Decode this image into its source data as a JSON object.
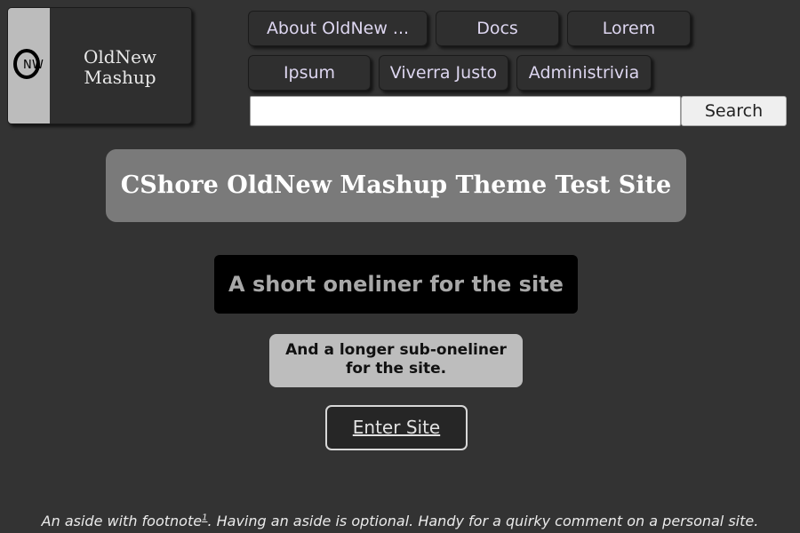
{
  "logo": {
    "line1": "OldNew",
    "line2": "Mashup",
    "mark_letters": [
      "O",
      "N",
      "W"
    ]
  },
  "nav": {
    "items": [
      "About OldNew ...",
      "Docs",
      "Lorem",
      "Ipsum",
      "Viverra Justo",
      "Administrivia"
    ]
  },
  "search": {
    "value": "",
    "placeholder": "",
    "button_label": "Search"
  },
  "site": {
    "title": "CShore OldNew Mashup Theme Test Site",
    "oneliner": "A short oneliner for the site",
    "sub_oneliner_line1": "And a longer sub-oneliner",
    "sub_oneliner_line2": "for the site.",
    "enter_label": "Enter Site"
  },
  "aside": {
    "before": "An aside with footnote",
    "footnote_ref": "1",
    "after": ". Having an aside is optional. Handy for a quirky comment on a personal site."
  },
  "colors": {
    "background": "#333333",
    "card": "#2f2f2f",
    "nav_text": "#ddd6f0",
    "title_bg": "#7a7a7a",
    "oneliner_bg": "#000000",
    "sub_oneliner_bg": "#bdbdbd"
  }
}
